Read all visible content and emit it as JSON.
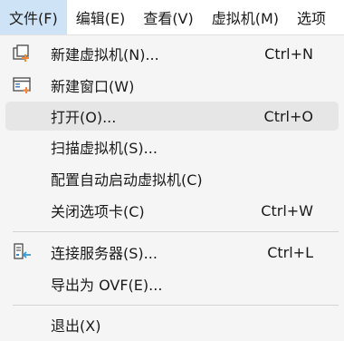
{
  "menubar": {
    "items": [
      {
        "label": "文件(F)"
      },
      {
        "label": "编辑(E)"
      },
      {
        "label": "查看(V)"
      },
      {
        "label": "虚拟机(M)"
      },
      {
        "label": "选项"
      }
    ]
  },
  "file_menu": {
    "items": [
      {
        "label": "新建虚拟机(N)...",
        "shortcut": "Ctrl+N",
        "icon": "new-vm-icon"
      },
      {
        "label": "新建窗口(W)",
        "shortcut": "",
        "icon": "new-window-icon"
      },
      {
        "label": "打开(O)...",
        "shortcut": "Ctrl+O",
        "icon": ""
      },
      {
        "label": "扫描虚拟机(S)...",
        "shortcut": "",
        "icon": ""
      },
      {
        "label": "配置自动启动虚拟机(C)",
        "shortcut": "",
        "icon": ""
      },
      {
        "label": "关闭选项卡(C)",
        "shortcut": "Ctrl+W",
        "icon": ""
      },
      {
        "label": "连接服务器(S)...",
        "shortcut": "Ctrl+L",
        "icon": "connect-server-icon"
      },
      {
        "label": "导出为 OVF(E)...",
        "shortcut": "",
        "icon": ""
      },
      {
        "label": "退出(X)",
        "shortcut": "",
        "icon": ""
      }
    ]
  },
  "colors": {
    "accent": "#f0883e",
    "menubar_active": "#cfe3f7",
    "menu_background": "#f5f5f5",
    "hover": "#e6e6e6"
  }
}
